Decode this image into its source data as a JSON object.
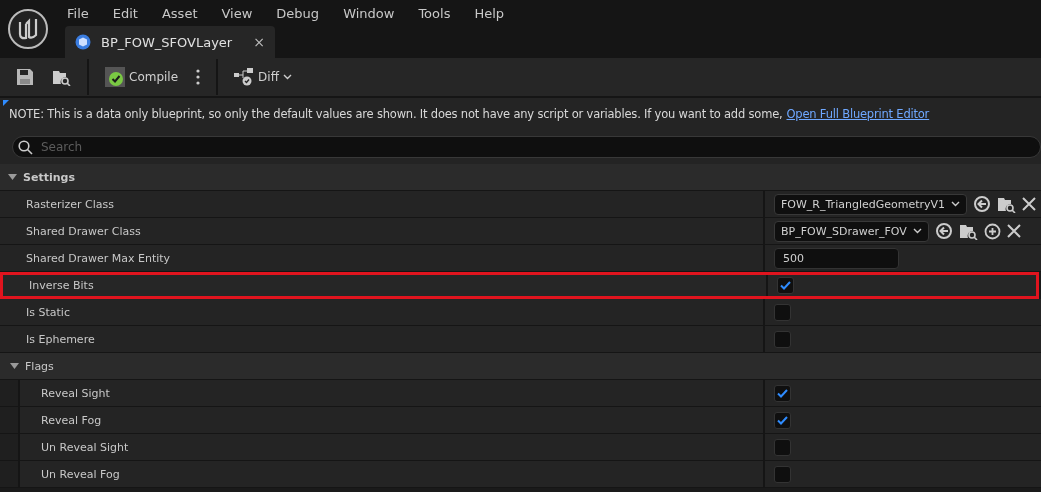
{
  "menu": [
    "File",
    "Edit",
    "Asset",
    "View",
    "Debug",
    "Window",
    "Tools",
    "Help"
  ],
  "tabs": [
    {
      "label": "BP_FOW_SFOVLayer",
      "selected": true,
      "close": "×"
    }
  ],
  "toolbar": [
    {
      "kind": "save"
    },
    {
      "kind": "browse"
    },
    {
      "kind": "compile",
      "label": "Compile"
    },
    {
      "kind": "more"
    },
    {
      "kind": "diff",
      "label": "Diff"
    }
  ],
  "note": {
    "text": "NOTE: This is a data only blueprint, so only the default values are shown.  It does not have any script or variables.  If you want to add some,",
    "link": "Open Full Blueprint Editor"
  },
  "search": {
    "placeholder": "Search"
  },
  "categories": [
    {
      "label": "Settings",
      "kind": "section",
      "expanded": true,
      "rows": [
        {
          "label": "Rasterizer Class",
          "kind": "object",
          "value": "FOW_R_TriangledGeometryV1",
          "can_create": false,
          "highlighted": false
        },
        {
          "label": "Shared Drawer Class",
          "kind": "object",
          "value": "BP_FOW_SDrawer_FOV",
          "can_create": true,
          "highlighted": false
        },
        {
          "label": "Shared Drawer Max Entity",
          "kind": "number",
          "value": "500",
          "highlighted": false
        },
        {
          "label": "Inverse Bits",
          "kind": "checkbox",
          "checked": true,
          "highlighted": true
        },
        {
          "label": "Is Static",
          "kind": "checkbox",
          "checked": false,
          "highlighted": false
        },
        {
          "label": "Is Ephemere",
          "kind": "checkbox",
          "checked": false,
          "highlighted": false
        }
      ]
    },
    {
      "label": "Flags",
      "kind": "struct",
      "expanded": true,
      "rows": [
        {
          "label": "Reveal Sight",
          "kind": "checkbox",
          "checked": true,
          "highlighted": false
        },
        {
          "label": "Reveal Fog",
          "kind": "checkbox",
          "checked": true,
          "highlighted": false
        },
        {
          "label": "Un Reveal Sight",
          "kind": "checkbox",
          "checked": false,
          "highlighted": false
        },
        {
          "label": "Un Reveal Fog",
          "kind": "checkbox",
          "checked": false,
          "highlighted": false
        }
      ]
    }
  ]
}
